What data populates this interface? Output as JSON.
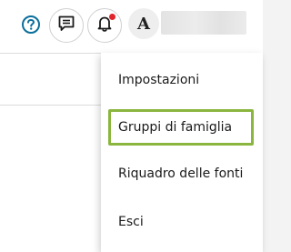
{
  "header": {
    "help_icon": "help-circle-icon",
    "feedback_icon": "chat-feedback-icon",
    "notifications_icon": "bell-icon",
    "notification_dot_color": "#e0242b",
    "avatar_initial": "A",
    "accent_color": "#0a6f9c"
  },
  "menu": {
    "items": [
      {
        "label": "Impostazioni"
      },
      {
        "label": "Gruppi di famiglia",
        "focused": true
      },
      {
        "label": "Riquadro delle fonti"
      },
      {
        "label": "Esci"
      }
    ],
    "focus_color": "#8ab63f"
  }
}
